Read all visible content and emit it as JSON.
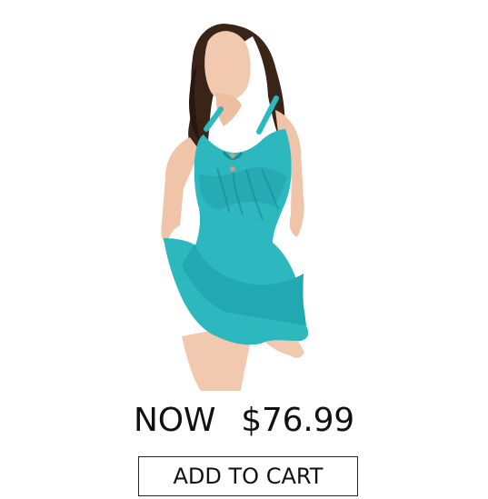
{
  "product": {
    "price_prefix": "NOW",
    "price": "$76.99"
  },
  "actions": {
    "add_to_cart_label": "ADD TO CART"
  },
  "colors": {
    "swimsuit": "#2db8c0",
    "swimsuit_shadow": "#1e9aa3",
    "skin": "#f0c9ae",
    "hair": "#3a2418"
  }
}
